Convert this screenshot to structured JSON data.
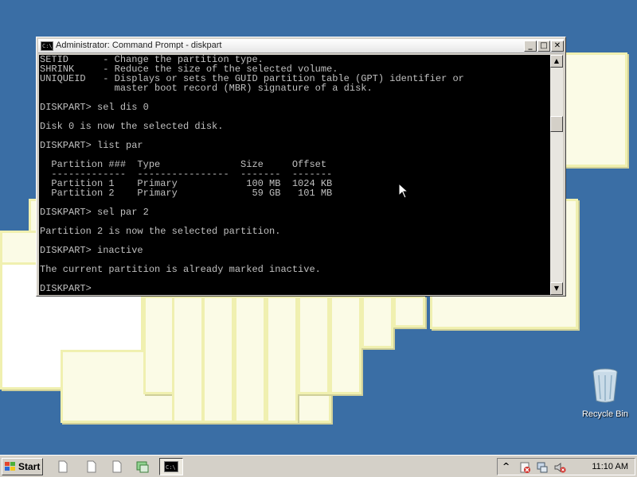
{
  "window": {
    "title": "Administrator: Command Prompt - diskpart",
    "buttons": {
      "minimize": "_",
      "maximize": "□",
      "close": "✕"
    }
  },
  "console": {
    "lines": [
      "SETID      - Change the partition type.",
      "SHRINK     - Reduce the size of the selected volume.",
      "UNIQUEID   - Displays or sets the GUID partition table (GPT) identifier or",
      "             master boot record (MBR) signature of a disk.",
      "",
      "DISKPART> sel dis 0",
      "",
      "Disk 0 is now the selected disk.",
      "",
      "DISKPART> list par",
      "",
      "  Partition ###  Type              Size     Offset",
      "  -------------  ----------------  -------  -------",
      "  Partition 1    Primary            100 MB  1024 KB",
      "  Partition 2    Primary             59 GB   101 MB",
      "",
      "DISKPART> sel par 2",
      "",
      "Partition 2 is now the selected partition.",
      "",
      "DISKPART> inactive",
      "",
      "The current partition is already marked inactive.",
      "",
      "DISKPART> "
    ]
  },
  "desktop": {
    "recycle_bin": {
      "label": "Recycle Bin",
      "icon": "recycle-bin-icon"
    }
  },
  "taskbar": {
    "start_label": "Start",
    "quick_launch": [
      "document-icon",
      "document-icon",
      "document-icon",
      "server-manager-icon"
    ],
    "task_icon": "command-prompt-icon",
    "tray": {
      "expand": "^",
      "clock": "11:10 AM"
    }
  },
  "colors": {
    "desktop": "#3a6ea5",
    "console_bg": "#000000",
    "console_fg": "#c0c0c0"
  }
}
